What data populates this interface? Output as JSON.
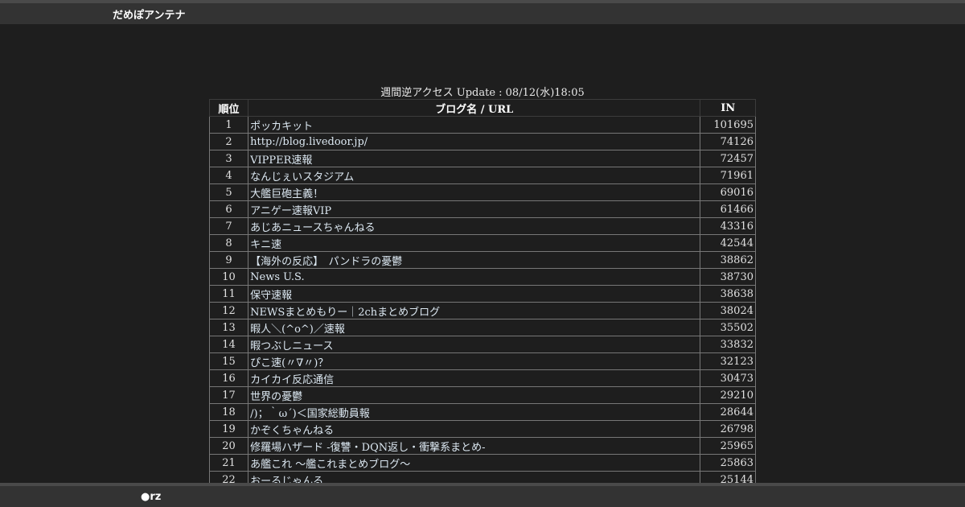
{
  "header": {
    "site_title": "だめぽアンテナ"
  },
  "ranking": {
    "caption": "週間逆アクセス Update : 08/12(水)18:05",
    "columns": {
      "rank": "順位",
      "blog": "ブログ名 / URL",
      "in": "IN"
    },
    "rows": [
      {
        "rank": "1",
        "name": "ポッカキット",
        "in": "101695"
      },
      {
        "rank": "2",
        "name": "http://blog.livedoor.jp/",
        "in": "74126"
      },
      {
        "rank": "3",
        "name": "VIPPER速報",
        "in": "72457"
      },
      {
        "rank": "4",
        "name": "なんじぇいスタジアム",
        "in": "71961"
      },
      {
        "rank": "5",
        "name": "大艦巨砲主義！",
        "in": "69016"
      },
      {
        "rank": "6",
        "name": "アニゲー速報VIP",
        "in": "61466"
      },
      {
        "rank": "7",
        "name": "あじあニュースちゃんねる",
        "in": "43316"
      },
      {
        "rank": "8",
        "name": "キニ速",
        "in": "42544"
      },
      {
        "rank": "9",
        "name": "【海外の反応】　パンドラの憂鬱",
        "in": "38862"
      },
      {
        "rank": "10",
        "name": "News U.S.",
        "in": "38730"
      },
      {
        "rank": "11",
        "name": "保守速報",
        "in": "38638"
      },
      {
        "rank": "12",
        "name": "NEWSまとめもりー｜2chまとめブログ",
        "in": "38024"
      },
      {
        "rank": "13",
        "name": "暇人＼(^o^)／速報",
        "in": "35502"
      },
      {
        "rank": "14",
        "name": "暇つぶしニュース",
        "in": "33832"
      },
      {
        "rank": "15",
        "name": "ぴこ速(〃∇〃)？",
        "in": "32123"
      },
      {
        "rank": "16",
        "name": "カイカイ反応通信",
        "in": "30473"
      },
      {
        "rank": "17",
        "name": "世界の憂鬱",
        "in": "29210"
      },
      {
        "rank": "18",
        "name": "/)；｀ω´)＜国家総動員報",
        "in": "28644"
      },
      {
        "rank": "19",
        "name": "かぞくちゃんねる",
        "in": "26798"
      },
      {
        "rank": "20",
        "name": "修羅場ハザード -復讐・DQN返し・衝撃系まとめ-",
        "in": "25965"
      },
      {
        "rank": "21",
        "name": "あ艦これ ～艦これまとめブログ～",
        "in": "25863"
      },
      {
        "rank": "22",
        "name": "おーるじゃんる",
        "in": "25144"
      }
    ]
  },
  "footer": {
    "text": "●rz"
  },
  "colors": {
    "background": "#1e1e1e",
    "bar": "#333333",
    "link": "#dce8f2"
  }
}
